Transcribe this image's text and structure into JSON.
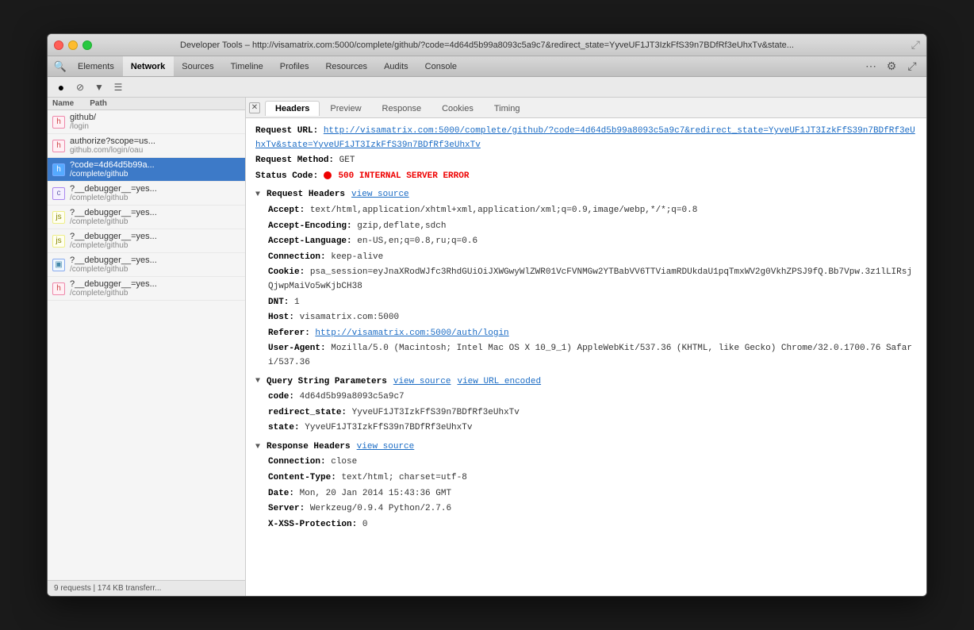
{
  "window": {
    "title": "Developer Tools – http://visamatrix.com:5000/complete/github/?code=4d64d5b99a8093c5a9c7&redirect_state=YyveUF1JT3IzkFfS39n7BDfRf3eUhxTv&state..."
  },
  "tabs": [
    {
      "id": "elements",
      "label": "Elements",
      "active": false
    },
    {
      "id": "network",
      "label": "Network",
      "active": true
    },
    {
      "id": "sources",
      "label": "Sources",
      "active": false
    },
    {
      "id": "timeline",
      "label": "Timeline",
      "active": false
    },
    {
      "id": "profiles",
      "label": "Profiles",
      "active": false
    },
    {
      "id": "resources",
      "label": "Resources",
      "active": false
    },
    {
      "id": "audits",
      "label": "Audits",
      "active": false
    },
    {
      "id": "console",
      "label": "Console",
      "active": false
    }
  ],
  "toolbar": {
    "record_label": "●",
    "clear_label": "⊘",
    "filter_label": "▼",
    "list_label": "☰"
  },
  "left_panel": {
    "col_name": "Name",
    "col_path": "Path",
    "items": [
      {
        "id": "github",
        "name": "github/",
        "path": "/login",
        "type": "html",
        "selected": false
      },
      {
        "id": "authorize",
        "name": "authorize?scope=us...",
        "path": "github.com/login/oau",
        "type": "html",
        "selected": false
      },
      {
        "id": "complete",
        "name": "?code=4d64d5b99a...",
        "path": "/complete/github",
        "type": "html",
        "selected": true
      },
      {
        "id": "debugger1",
        "name": "?__debugger__=yes...",
        "path": "/complete/github",
        "type": "css",
        "selected": false
      },
      {
        "id": "debugger2",
        "name": "?__debugger__=yes...",
        "path": "/complete/github",
        "type": "js",
        "selected": false
      },
      {
        "id": "debugger3",
        "name": "?__debugger__=yes...",
        "path": "/complete/github",
        "type": "js",
        "selected": false
      },
      {
        "id": "debugger4",
        "name": "?__debugger__=yes...",
        "path": "/complete/github",
        "type": "img",
        "selected": false
      },
      {
        "id": "debugger5",
        "name": "?__debugger__=yes...",
        "path": "/complete/github",
        "type": "html",
        "selected": false
      }
    ],
    "status": "9 requests | 174 KB transferr..."
  },
  "detail": {
    "tabs": [
      {
        "id": "headers",
        "label": "Headers",
        "active": true
      },
      {
        "id": "preview",
        "label": "Preview",
        "active": false
      },
      {
        "id": "response",
        "label": "Response",
        "active": false
      },
      {
        "id": "cookies",
        "label": "Cookies",
        "active": false
      },
      {
        "id": "timing",
        "label": "Timing",
        "active": false
      }
    ],
    "request_url_label": "Request URL:",
    "request_url_value": "http://visamatrix.com:5000/complete/github/?code=4d64d5b99a8093c5a9c7&redirect_state=YyveUF1JT3IzkFfS39n7BDfRf3eUhxTv&state=YyveUF1JT3IzkFfS39n7BDfRf3eUhxTv",
    "request_method_label": "Request Method:",
    "request_method_value": "GET",
    "status_code_label": "Status Code:",
    "status_code_value": "500 INTERNAL SERVER ERROR",
    "request_headers_label": "Request Headers",
    "request_headers_source": "view source",
    "accept_label": "Accept:",
    "accept_value": "text/html,application/xhtml+xml,application/xml;q=0.9,image/webp,*/*;q=0.8",
    "accept_encoding_label": "Accept-Encoding:",
    "accept_encoding_value": "gzip,deflate,sdch",
    "accept_language_label": "Accept-Language:",
    "accept_language_value": "en-US,en;q=0.8,ru;q=0.6",
    "connection_label": "Connection:",
    "connection_value": "keep-alive",
    "cookie_label": "Cookie:",
    "cookie_value": "psa_session=eyJnaXRodWJfc3RhdGUiOiJXWGwyWlZWR01VcFVNMGw2YTBabVV6TTViamRDUkdaU1pqTmxWV2g0VkhZPSJ9fQ.Bb7Vpw.3z1lLIRsjQjwpMaiVo5wKjbCH38",
    "dnt_label": "DNT:",
    "dnt_value": "1",
    "host_label": "Host:",
    "host_value": "visamatrix.com:5000",
    "referer_label": "Referer:",
    "referer_value": "http://visamatrix.com:5000/auth/login",
    "useragent_label": "User-Agent:",
    "useragent_value": "Mozilla/5.0 (Macintosh; Intel Mac OS X 10_9_1) AppleWebKit/537.36 (KHTML, like Gecko) Chrome/32.0.1700.76 Safari/537.36",
    "query_string_label": "Query String Parameters",
    "query_string_source": "view source",
    "query_string_url_encoded": "view URL encoded",
    "code_label": "code:",
    "code_value": "4d64d5b99a8093c5a9c7",
    "redirect_state_label": "redirect_state:",
    "redirect_state_value": "YyveUF1JT3IzkFfS39n7BDfRf3eUhxTv",
    "state_label": "state:",
    "state_value": "YyveUF1JT3IzkFfS39n7BDfRf3eUhxTv",
    "response_headers_label": "Response Headers",
    "response_headers_source": "view source",
    "resp_connection_label": "Connection:",
    "resp_connection_value": "close",
    "resp_content_type_label": "Content-Type:",
    "resp_content_type_value": "text/html; charset=utf-8",
    "resp_date_label": "Date:",
    "resp_date_value": "Mon, 20 Jan 2014 15:43:36 GMT",
    "resp_server_label": "Server:",
    "resp_server_value": "Werkzeug/0.9.4 Python/2.7.6",
    "resp_xss_label": "X-XSS-Protection:",
    "resp_xss_value": "0"
  }
}
